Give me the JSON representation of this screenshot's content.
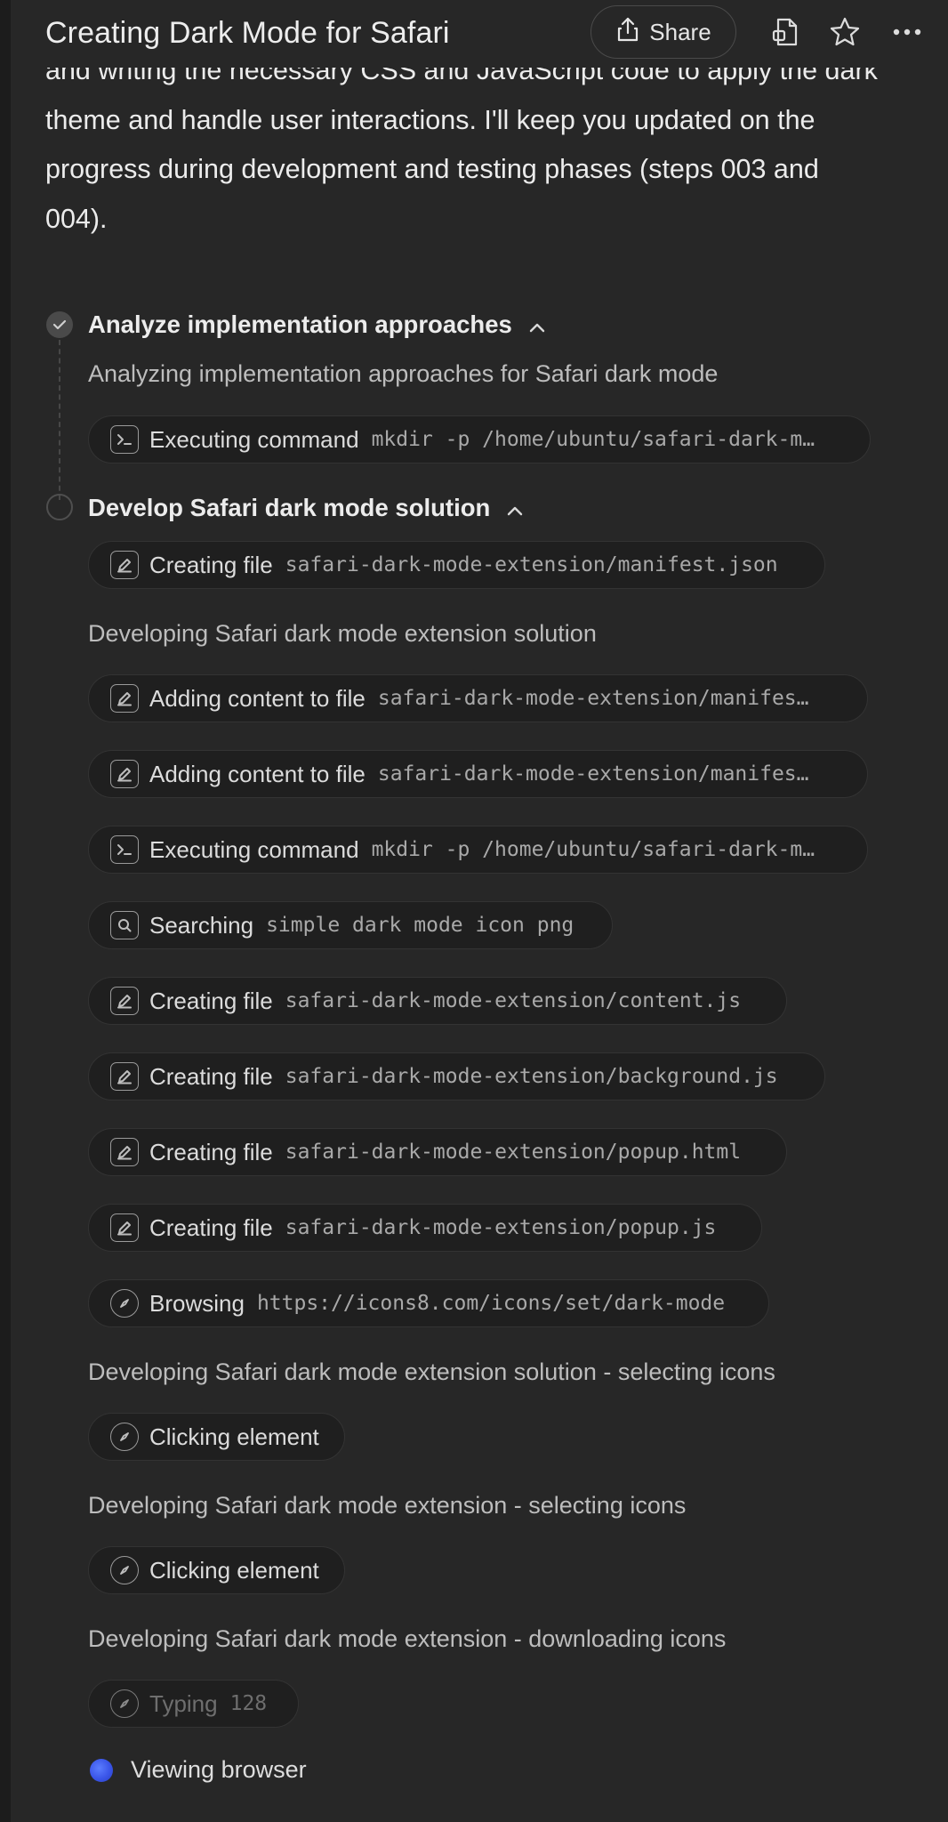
{
  "header": {
    "title": "Creating Dark Mode for Safari",
    "share_label": "Share",
    "icons": [
      "share-icon",
      "document-icon",
      "star-icon",
      "more-icon"
    ]
  },
  "intro": {
    "lines": [
      "and writing the necessary CSS and JavaScript code to apply the dark",
      "theme and handle user interactions. I'll keep you updated on the",
      "progress during development and testing phases (steps 003 and",
      "004)."
    ]
  },
  "steps": [
    {
      "title": "Analyze implementation approaches",
      "status": "done",
      "description": "Analyzing implementation approaches for Safari dark mode",
      "actions": [
        {
          "icon": "terminal-icon",
          "action": "Executing command",
          "arg": "mkdir -p /home/ubuntu/safari-dark-m…"
        }
      ]
    },
    {
      "title": "Develop Safari dark mode solution",
      "status": "in-progress",
      "actions": [
        {
          "icon": "edit-icon",
          "action": "Creating file",
          "arg": "safari-dark-mode-extension/manifest.json"
        }
      ],
      "notes": [
        "Developing Safari dark mode extension solution",
        "Developing Safari dark mode extension solution - selecting icons",
        "Developing Safari dark mode extension - selecting icons",
        "Developing Safari dark mode extension - downloading icons"
      ],
      "actions2": [
        {
          "icon": "edit-icon",
          "action": "Adding content to file",
          "arg": "safari-dark-mode-extension/manifes…"
        },
        {
          "icon": "edit-icon",
          "action": "Adding content to file",
          "arg": "safari-dark-mode-extension/manifes…"
        },
        {
          "icon": "terminal-icon",
          "action": "Executing command",
          "arg": "mkdir -p /home/ubuntu/safari-dark-m…"
        },
        {
          "icon": "search-icon",
          "action": "Searching",
          "arg": "simple dark mode icon png"
        },
        {
          "icon": "edit-icon",
          "action": "Creating file",
          "arg": "safari-dark-mode-extension/content.js"
        },
        {
          "icon": "edit-icon",
          "action": "Creating file",
          "arg": "safari-dark-mode-extension/background.js"
        },
        {
          "icon": "edit-icon",
          "action": "Creating file",
          "arg": "safari-dark-mode-extension/popup.html"
        },
        {
          "icon": "edit-icon",
          "action": "Creating file",
          "arg": "safari-dark-mode-extension/popup.js"
        },
        {
          "icon": "compass-icon",
          "action": "Browsing",
          "arg": "https://icons8.com/icons/set/dark-mode"
        }
      ],
      "actions3": [
        {
          "icon": "compass-icon",
          "action": "Clicking element",
          "arg": ""
        }
      ],
      "actions4": [
        {
          "icon": "compass-icon",
          "action": "Clicking element",
          "arg": ""
        }
      ],
      "actions5": [
        {
          "icon": "compass-icon",
          "action": "Typing",
          "arg": "128"
        }
      ]
    }
  ],
  "footer": {
    "viewing_label": "Viewing browser"
  }
}
